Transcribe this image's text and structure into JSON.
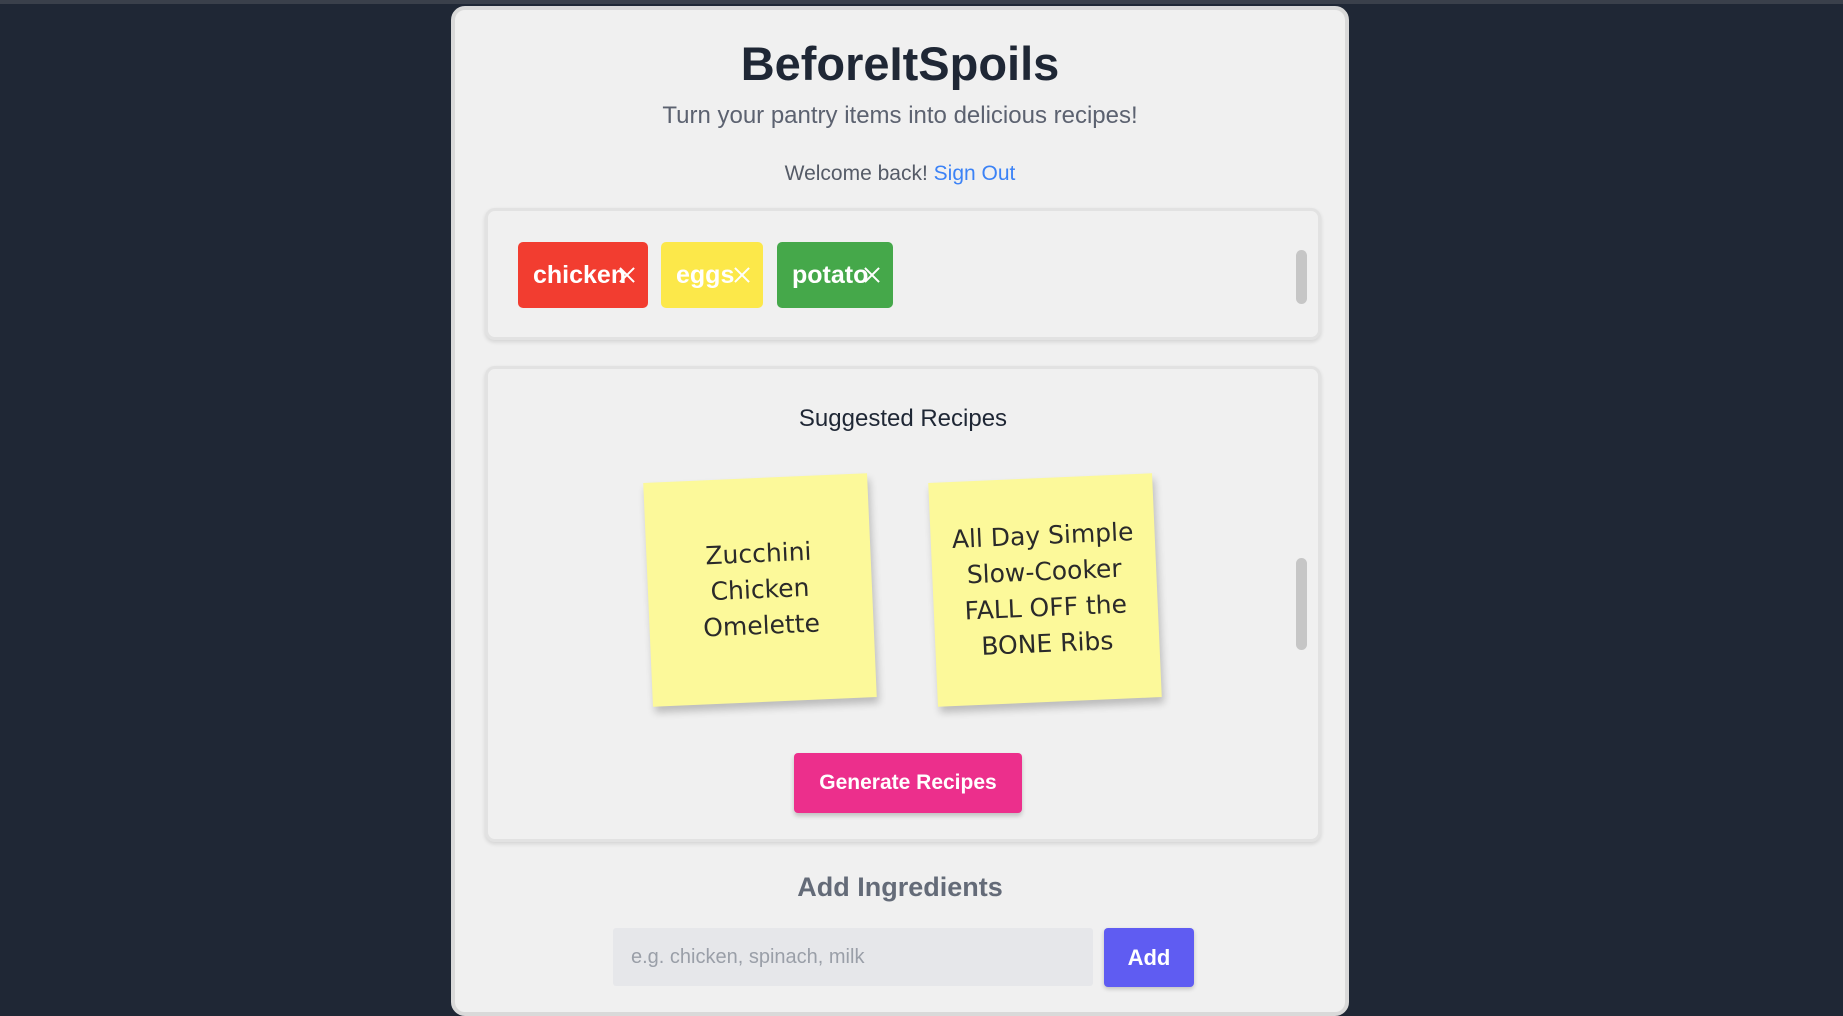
{
  "app": {
    "title": "BeforeItSpoils",
    "subtitle": "Turn your pantry items into delicious recipes!",
    "welcome_text": "Welcome back!",
    "sign_out_label": "Sign Out"
  },
  "ingredients": [
    {
      "label": "chicken",
      "color": "#f23d30",
      "close_icon": "close-icon"
    },
    {
      "label": "eggs",
      "color": "#fce84a",
      "close_icon": "close-icon"
    },
    {
      "label": "potato",
      "color": "#45a84a",
      "close_icon": "close-icon"
    }
  ],
  "recipes": {
    "heading": "Suggested Recipes",
    "items": [
      {
        "title": "Zucchini Chicken Omelette",
        "color": "#fcf99a"
      },
      {
        "title": "All Day Simple Slow-Cooker FALL OFF the BONE Ribs",
        "color": "#fcf99a"
      }
    ],
    "generate_label": "Generate Recipes"
  },
  "add_ingredients": {
    "heading": "Add Ingredients",
    "input_placeholder": "e.g. chicken, spinach, milk",
    "input_value": "",
    "add_label": "Add"
  },
  "colors": {
    "background": "#1f2735",
    "link": "#3b82f6",
    "generate_button": "#ec2f8c",
    "add_button": "#5f5cf2"
  }
}
